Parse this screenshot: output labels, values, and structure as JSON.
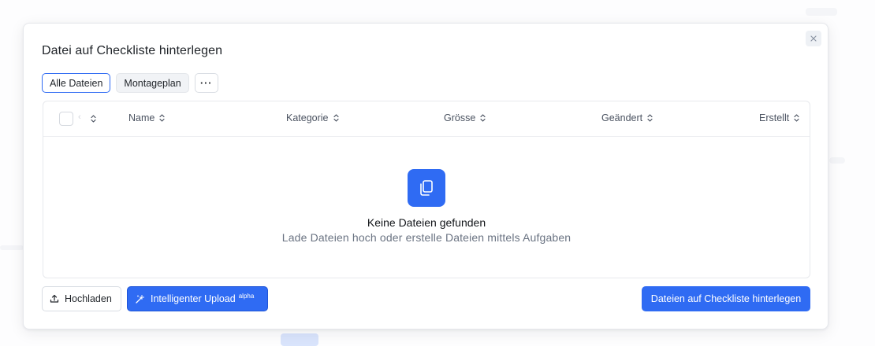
{
  "dialog": {
    "title": "Datei auf Checkliste hinterlegen",
    "close_icon": "close-icon"
  },
  "tabs": [
    {
      "label": "Alle Dateien",
      "active": true
    },
    {
      "label": "Montageplan",
      "active": false
    },
    {
      "label": "···",
      "active": false
    }
  ],
  "table": {
    "columns": [
      "Name",
      "Kategorie",
      "Grösse",
      "Geändert",
      "Erstellt"
    ],
    "rows": []
  },
  "empty_state": {
    "icon": "files-copy-icon",
    "title": "Keine Dateien gefunden",
    "subtitle": "Lade Dateien hoch oder erstelle Dateien mittels Aufgaben"
  },
  "footer": {
    "upload_label": "Hochladen",
    "smart_upload_label": "Intelligenter Upload",
    "smart_upload_badge": "alpha",
    "primary_label": "Dateien auf Checkliste hinterlegen"
  },
  "colors": {
    "accent": "#2f6bf3",
    "border": "#e7e9ed",
    "muted_text": "#6a7382"
  }
}
